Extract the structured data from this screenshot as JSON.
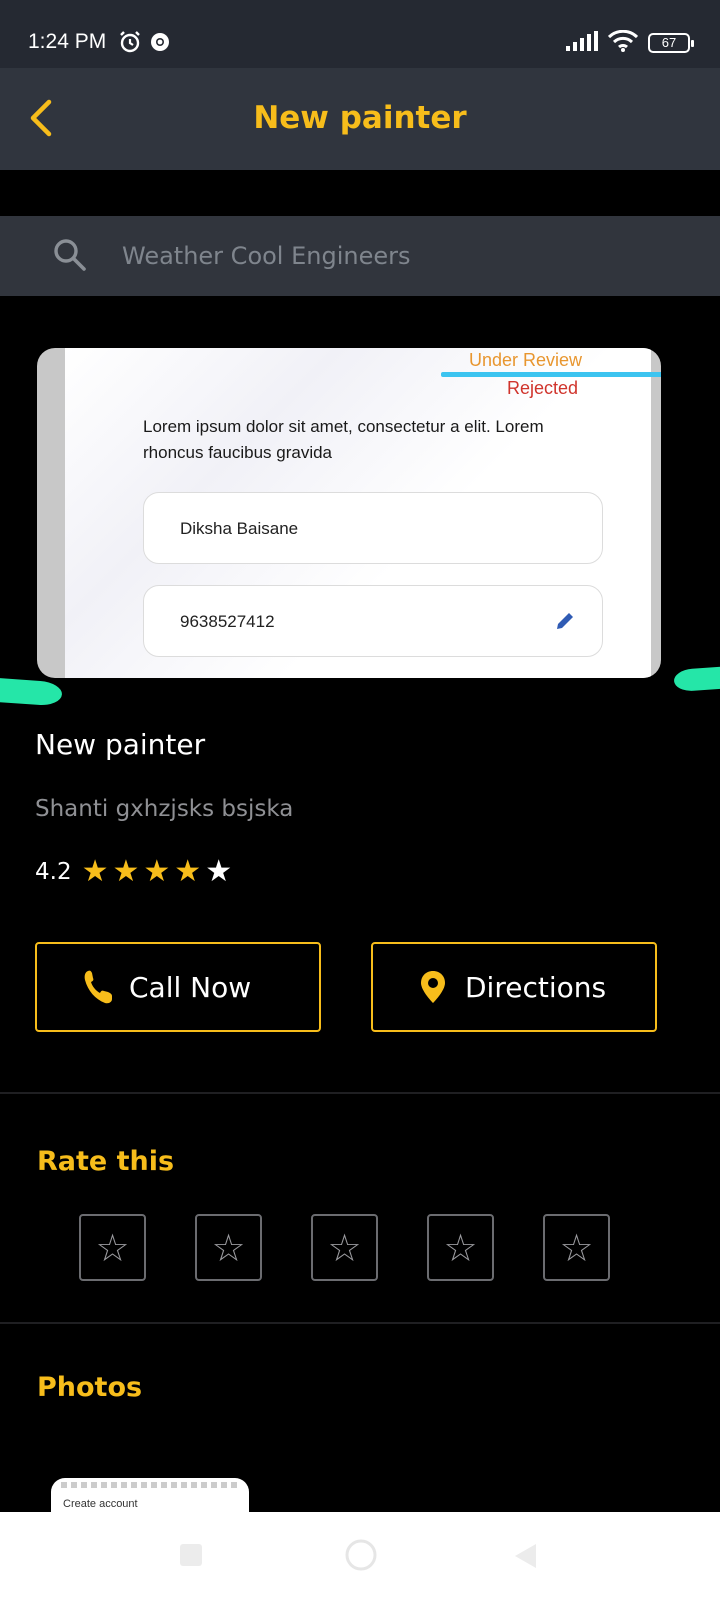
{
  "status_bar": {
    "time": "1:24 PM",
    "battery": "67"
  },
  "app_bar": {
    "title": "New painter"
  },
  "search": {
    "placeholder": "Weather Cool Engineers",
    "value": ""
  },
  "card_screenshot": {
    "status_under_review": "Under Review",
    "status_rejected": "Rejected",
    "description": "Lorem ipsum dolor sit amet, consectetur a elit. Lorem rhoncus faucibus gravida",
    "name_field": "Diksha Baisane",
    "phone_field": "9638527412"
  },
  "listing": {
    "name": "New painter",
    "address": "Shanti gxhzjsks bsjska",
    "rating": "4.2",
    "filled_stars": 4,
    "total_stars": 5
  },
  "actions": {
    "call_label": "Call Now",
    "directions_label": "Directions"
  },
  "rate_section": {
    "title": "Rate this",
    "star_count": 5
  },
  "photos_section": {
    "title": "Photos",
    "thumb_text": "Create account"
  },
  "colors": {
    "accent": "#f7bd1b",
    "appbar_bg": "#30353e",
    "search_bg": "#31353d",
    "background": "#000000"
  }
}
